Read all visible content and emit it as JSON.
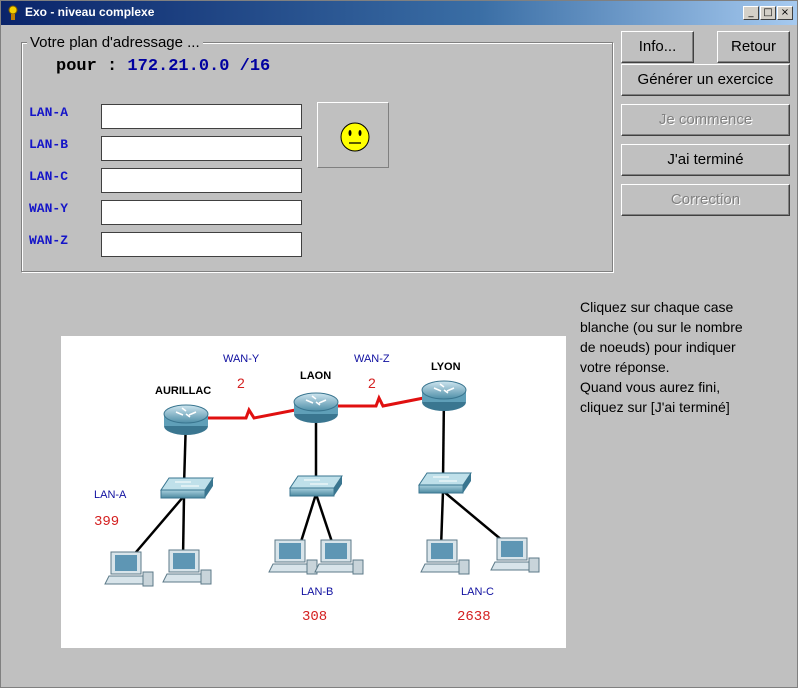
{
  "window": {
    "title": "Exo - niveau complexe",
    "buttons": [
      "_",
      "□",
      "×"
    ]
  },
  "plan": {
    "group_title": "Votre plan d'adressage ...",
    "prefix": "pour :",
    "network": "172.21.0.0 /16"
  },
  "fields": [
    {
      "label": "LAN-A",
      "value": ""
    },
    {
      "label": "LAN-B",
      "value": ""
    },
    {
      "label": "LAN-C",
      "value": ""
    },
    {
      "label": "WAN-Y",
      "value": ""
    },
    {
      "label": "WAN-Z",
      "value": ""
    }
  ],
  "status_icon": "neutral-smiley-icon",
  "buttons": {
    "info": "Info...",
    "retour": "Retour",
    "generer": "Générer un exercice",
    "commence": "Je commence",
    "termine": "J'ai terminé",
    "correction": "Correction"
  },
  "instructions": [
    "Cliquez sur chaque case",
    "blanche (ou sur le nombre",
    "de noeuds) pour indiquer",
    "votre réponse.",
    "Quand vous aurez fini,",
    "cliquez sur [J'ai terminé]"
  ],
  "diagram": {
    "routers": [
      "AURILLAC",
      "LAON",
      "LYON"
    ],
    "wan_links": [
      {
        "name": "WAN-Y",
        "nodes": "2"
      },
      {
        "name": "WAN-Z",
        "nodes": "2"
      }
    ],
    "lans": [
      {
        "name": "LAN-A",
        "nodes": "399"
      },
      {
        "name": "LAN-B",
        "nodes": "308"
      },
      {
        "name": "LAN-C",
        "nodes": "2638"
      }
    ]
  },
  "colors": {
    "label_blue": "#1515c8",
    "network_blue": "#0000a0",
    "count_red": "#d42020",
    "wan_link": "#e01010",
    "titlebar": "#0a246a"
  }
}
